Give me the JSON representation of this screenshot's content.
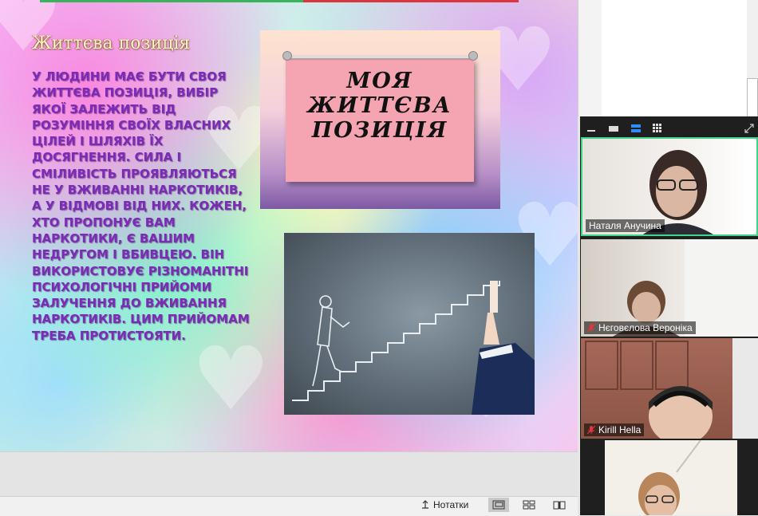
{
  "slide": {
    "title": "Життєва позиція",
    "body": "У людини має бути своя життєва позиція, вибір якої залежить від розуміння своїх власних цілей і шляхів їх досягнення. Сила і сміливість проявляються не у вживанні наркотиків, а у відмові від них. Кожен, хто пропонує вам наркотики, є вашим недругом і вбивцею. Він використовує різноманітні психологічні прийоми залучення до вживання наркотиків. Цим прийомам треба протистояти.",
    "poster_lines": [
      "МОЯ",
      "ЖИТТЄВА",
      "ПОЗИЦІЯ"
    ]
  },
  "ppt_status": {
    "notes_label": "Нотатки"
  },
  "zoom": {
    "participants": [
      {
        "name": "Наталя Анучина",
        "muted": false,
        "active": true
      },
      {
        "name": "Нєговєлова Вероніка",
        "muted": true,
        "active": false
      },
      {
        "name": "Kirill Hella",
        "muted": true,
        "active": false
      },
      {
        "name": "",
        "muted": false,
        "active": false
      }
    ]
  },
  "colors": {
    "slide_text": "#7b2bb5",
    "title_text": "#fff3c9",
    "active_speaker_border": "#3fd68a",
    "mic_muted": "#e0363e"
  },
  "icons": [
    "minimize-icon",
    "speaker-view-icon",
    "gallery-strip-icon",
    "gallery-grid-icon",
    "expand-icon",
    "notes-icon",
    "normal-view-icon",
    "slide-sorter-icon",
    "reading-view-icon",
    "mic-muted-icon"
  ]
}
